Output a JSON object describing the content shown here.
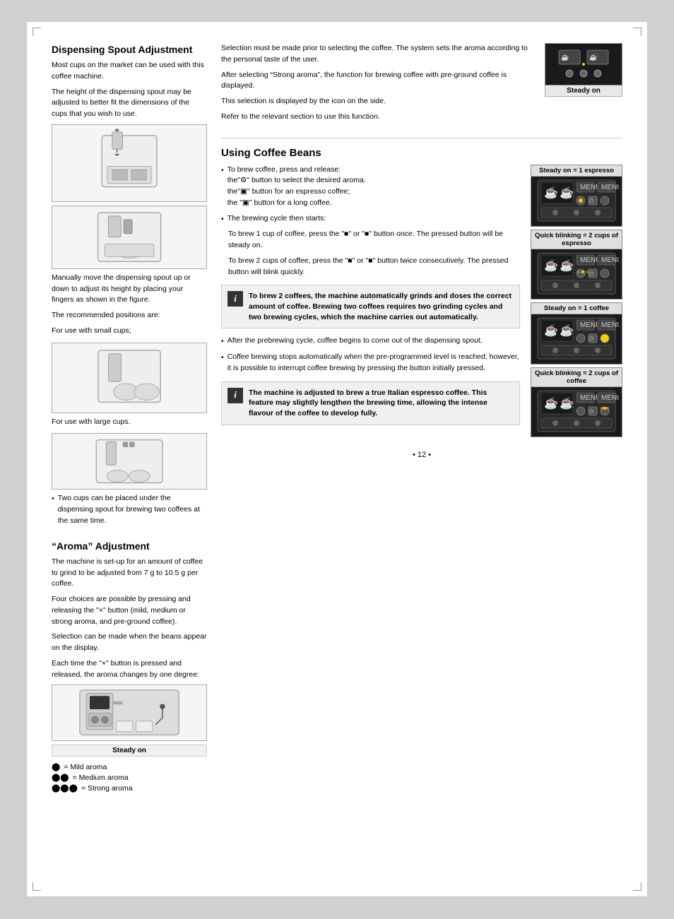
{
  "page": {
    "number": "• 12 •"
  },
  "dispensing_spout": {
    "title": "Dispensing Spout Adjustment",
    "para1": "Most cups on the market can be used with this coffee machine.",
    "para2": "The height of the dispensing spout may be adjusted to better fit the dimensions of the cups that you wish to use.",
    "para3": "Manually move the dispensing spout up or down to adjust its height by placing your fingers as shown in the figure.",
    "para4": "The recommended positions are:",
    "para5": "For use with small cups;",
    "para6": "For use with large cups.",
    "bullet1": "Two cups can be placed under the dispensing spout for brewing two coffees at the same time."
  },
  "aroma": {
    "title": "“Aroma” Adjustment",
    "para1": "The machine is set-up for an amount of coffee to grind to be adjusted from 7 g to 10.5 g per coffee.",
    "para2": "Four choices are possible by pressing and releasing the \"×\" button (mild, medium or strong aroma, and pre-ground coffee).",
    "para3": "Selection can be made when the beans appear on the display.",
    "para4": "Each time the \"×\" button is pressed and released, the aroma changes by one degree:",
    "steady_label": "Steady on",
    "legend": [
      {
        "icon": "●",
        "text": "= Mild aroma"
      },
      {
        "icon": "●●",
        "text": "= Medium aroma"
      },
      {
        "icon": "●●●",
        "text": "= Strong aroma"
      }
    ]
  },
  "right_top": {
    "para1": "Selection must be made prior to selecting the coffee. The system sets the aroma according to the personal taste of the user.",
    "para2": "After selecting “Strong aroma”, the function for brewing coffee with pre-ground coffee is displayed.",
    "para3": "This selection is displayed by the icon on the side.",
    "para4": "Refer to the relevant section to use this function.",
    "steady_label": "Steady on"
  },
  "using_coffee_beans": {
    "title": "Using Coffee Beans",
    "intro": "To brew coffee, press and release:",
    "items": [
      "the\"×\" button to select the desired aroma.",
      "the\"■\" button for an espresso coffee;",
      "the \"■\" button for a long coffee."
    ],
    "brewing_cycle": "The brewing cycle then starts:",
    "brew1cup": "To brew 1 cup of coffee, press the \"■\" or \"■\" button once. The pressed button will be steady on.",
    "brew2cup": "To brew 2 cups of coffee, press the \"■\" or \"■\" button twice consecutively. The pressed button will blink quickly.",
    "info1": "To brew 2 coffees, the machine automatically grinds and doses the correct amount of coffee. Brewing two coffees requires two grinding cycles and two brewing cycles, which the machine carries out automatically.",
    "bullet2": "After the prebrewing cycle, coffee begins to come out of the dispensing spout.",
    "bullet3": "Coffee brewing stops automatically when the pre-programmed level is reached; however, it is possible to interrupt coffee brewing by pressing the button initially pressed.",
    "info2": "The machine is adjusted to brew a true Italian espresso coffee. This feature may slightly lengthen the brewing time, allowing the intense flavour of the coffee to develop fully."
  },
  "panels": [
    {
      "label": "Steady on = 1 espresso",
      "type": "dark",
      "blink": false
    },
    {
      "label": "Quick blinking = 2 cups of espresso",
      "type": "dark",
      "blink": true
    },
    {
      "label": "Steady on = 1 coffee",
      "type": "dark",
      "blink": false
    },
    {
      "label": "Quick blinking = 2 cups of coffee",
      "type": "dark",
      "blink": true
    }
  ]
}
